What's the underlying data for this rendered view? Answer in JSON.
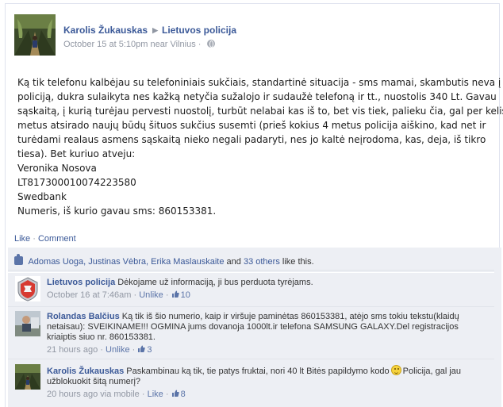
{
  "post": {
    "author": "Karolis Žukauskas",
    "target": "Lietuvos policija",
    "timestamp": "October 15 at 5:10pm near Vilnius",
    "privacy_icon": "globe-icon",
    "lines": [
      "Ką tik telefonu kalbėjau su telefoniniais sukčiais, standartinė situacija - sms mamai, skambutis neva į",
      "policiją, dukra sulaikyta nes kažką netyčia sužalojo ir sudaužė telefoną ir tt., nuostolis 340 Lt. Gavau",
      "sąskaitą, į kurią turėjau pervesti nuostolį, turbūt nelabai kas iš to, bet vis tiek, palieku čia, gal per kelis",
      "metus atsirado naujų būdų šituos sukčius susemti (prieš kokius 4 metus policija aiškino, kad net ir",
      "turėdami realaus asmens sąskaitą nieko negali padaryti, nes jo kaltė neįrodoma, kas, deja, iš tikro",
      "tiesa). Bet kuriuo atveju:",
      "Veronika Nosova",
      "LT817300010074223580",
      "Swedbank",
      "Numeris, iš kurio gavau sms: 860153381."
    ]
  },
  "actions": {
    "like": "Like",
    "separator": "·",
    "comment": "Comment"
  },
  "likes": {
    "names": "Adomas Uoga, Justinas Vėbra, Erika Maslauskaite",
    "and": "and",
    "others": "33 others",
    "suffix": "like this."
  },
  "comments": [
    {
      "author": "Lietuvos policija",
      "text": "Dėkojame už informaciją, ji bus perduota tyrėjams.",
      "time": "October 16 at 7:46am",
      "action": "Unlike",
      "likes": "10"
    },
    {
      "author": "Rolandas Balčius",
      "text": "Ką tik iš šio numerio, kaip ir viršuje paminėtas 860153381, atėjo sms tokiu tekstu(klaidų netaisau): SVEIKINAME!!! OGMINA jums dovanoja 1000lt.ir telefona SAMSUNG GALAXY.Del registracijos kriaiptis siuo nr. 860153381.",
      "time": "21 hours ago",
      "action": "Unlike",
      "likes": "3"
    },
    {
      "author": "Karolis Žukauskas",
      "text_before": "Paskambinau ką tik, tie patys fruktai, nori 40 lt Bitės papildymo kodo",
      "text_after": "Policija, gal jau užblokuokit šitą numerį?",
      "time": "20 hours ago via mobile",
      "action": "Like",
      "likes": "8"
    }
  ],
  "meta_separator": "·",
  "colors": {
    "link": "#3b5998",
    "muted": "#9197a3",
    "ufi_bg": "#edeff4"
  }
}
